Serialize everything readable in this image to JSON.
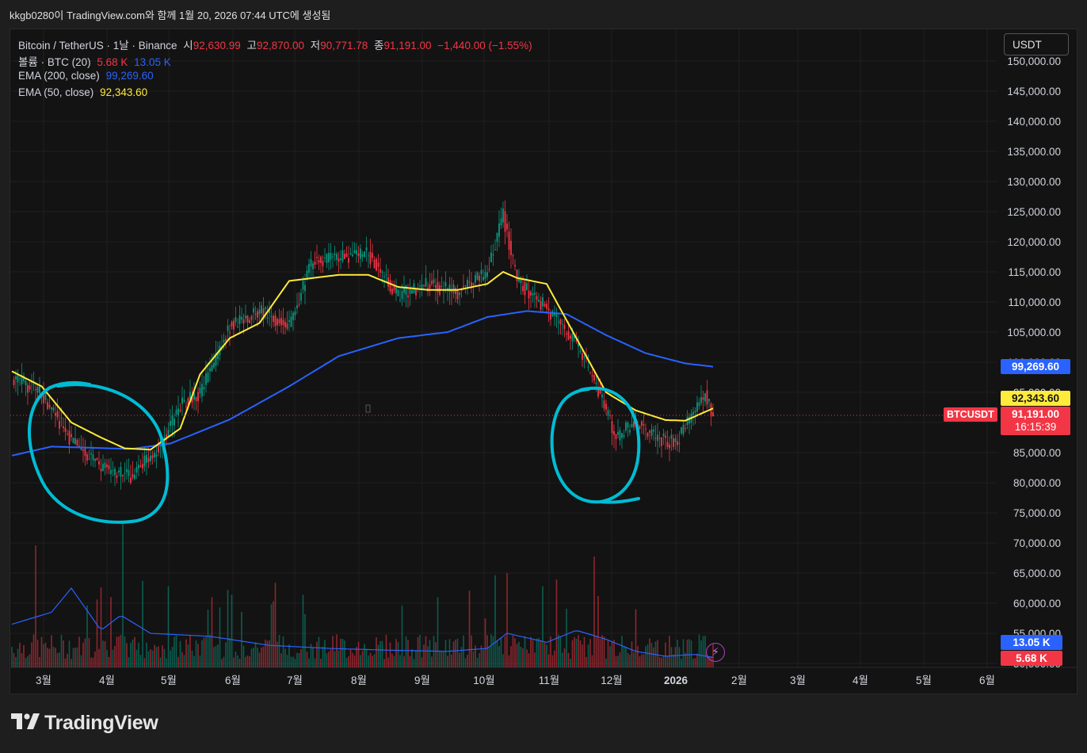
{
  "header": {
    "text": "kkgb0280이 TradingView.com와 함께 1월 20, 2026 07:44 UTC에 생성됨"
  },
  "legend": {
    "symbol": "Bitcoin / TetherUS · 1날 · Binance",
    "open_label": "시",
    "open": "92,630.99",
    "high_label": "고",
    "high": "92,870.00",
    "low_label": "저",
    "low": "90,771.78",
    "close_label": "종",
    "close": "91,191.00",
    "change": "−1,440.00 (−1.55%)",
    "volume_label": "볼륨 · BTC (20)",
    "volume": "5.68 K",
    "volume_ma": "13.05 K",
    "ema200_label": "EMA (200, close)",
    "ema200": "99,269.60",
    "ema50_label": "EMA (50, close)",
    "ema50": "92,343.60"
  },
  "currency_button": "USDT",
  "tags": {
    "ema200": "99,269.60",
    "ema50": "92,343.60",
    "symbol": "BTCUSDT",
    "price": "91,191.00",
    "countdown": "16:15:39",
    "volume_ma": "13.05 K",
    "volume": "5.68 K"
  },
  "footer_logo": "TradingView",
  "colors": {
    "up": "#089981",
    "down": "#f23645",
    "ema50": "#ffeb3b",
    "ema200": "#2962ff",
    "annotation": "#00bcd4",
    "background": "#131313"
  },
  "chart_data": {
    "type": "candlestick",
    "interval": "1D",
    "y_axis_ticks": [
      "150,000.00",
      "145,000.00",
      "140,000.00",
      "135,000.00",
      "130,000.00",
      "125,000.00",
      "120,000.00",
      "115,000.00",
      "110,000.00",
      "105,000.00",
      "100,000.00",
      "95,000.00",
      "90,000.00",
      "85,000.00",
      "80,000.00",
      "75,000.00",
      "70,000.00",
      "65,000.00",
      "60,000.00",
      "55,000.00",
      "50,000.00"
    ],
    "x_axis_ticks": [
      "3월",
      "4월",
      "5월",
      "6월",
      "7월",
      "8월",
      "9월",
      "10월",
      "11월",
      "12월",
      "2026",
      "2월",
      "3월",
      "4월",
      "5월",
      "6월"
    ],
    "ylim": [
      47000,
      152000
    ],
    "price_path": [
      [
        0,
        97500
      ],
      [
        15,
        95000
      ],
      [
        30,
        87000
      ],
      [
        45,
        82500
      ],
      [
        60,
        81000
      ],
      [
        75,
        86000
      ],
      [
        85,
        93000
      ],
      [
        95,
        94800
      ],
      [
        110,
        106000
      ],
      [
        125,
        108500
      ],
      [
        140,
        106000
      ],
      [
        152,
        117000
      ],
      [
        165,
        117500
      ],
      [
        180,
        118000
      ],
      [
        195,
        111000
      ],
      [
        210,
        113000
      ],
      [
        225,
        111500
      ],
      [
        240,
        115000
      ],
      [
        248,
        124500
      ],
      [
        255,
        113500
      ],
      [
        270,
        109000
      ],
      [
        285,
        103000
      ],
      [
        295,
        96000
      ],
      [
        305,
        87500
      ],
      [
        315,
        90000
      ],
      [
        325,
        87500
      ],
      [
        335,
        86500
      ],
      [
        345,
        92000
      ],
      [
        350,
        94800
      ],
      [
        354,
        91191
      ]
    ],
    "ema50_path": [
      [
        0,
        98500
      ],
      [
        15,
        96000
      ],
      [
        30,
        90000
      ],
      [
        45,
        87500
      ],
      [
        57,
        85700
      ],
      [
        70,
        85500
      ],
      [
        85,
        89000
      ],
      [
        95,
        98000
      ],
      [
        110,
        104000
      ],
      [
        125,
        106500
      ],
      [
        140,
        113500
      ],
      [
        165,
        114500
      ],
      [
        180,
        114500
      ],
      [
        195,
        112500
      ],
      [
        210,
        112000
      ],
      [
        225,
        112000
      ],
      [
        240,
        113000
      ],
      [
        248,
        115000
      ],
      [
        255,
        114000
      ],
      [
        270,
        113000
      ],
      [
        285,
        104000
      ],
      [
        300,
        95000
      ],
      [
        315,
        92000
      ],
      [
        330,
        90400
      ],
      [
        340,
        90300
      ],
      [
        354,
        92343
      ]
    ],
    "ema200_path": [
      [
        0,
        84500
      ],
      [
        20,
        86000
      ],
      [
        60,
        85600
      ],
      [
        80,
        86500
      ],
      [
        110,
        90500
      ],
      [
        140,
        96000
      ],
      [
        165,
        101000
      ],
      [
        195,
        104000
      ],
      [
        220,
        105000
      ],
      [
        240,
        107500
      ],
      [
        260,
        108500
      ],
      [
        280,
        108000
      ],
      [
        300,
        104500
      ],
      [
        320,
        101500
      ],
      [
        340,
        99800
      ],
      [
        354,
        99269
      ]
    ],
    "volume_ma_path": [
      [
        0,
        56500
      ],
      [
        20,
        58500
      ],
      [
        30,
        62500
      ],
      [
        45,
        55500
      ],
      [
        55,
        58000
      ],
      [
        70,
        55000
      ],
      [
        100,
        54500
      ],
      [
        130,
        53000
      ],
      [
        160,
        52500
      ],
      [
        190,
        52200
      ],
      [
        220,
        52000
      ],
      [
        240,
        52500
      ],
      [
        250,
        55000
      ],
      [
        270,
        53500
      ],
      [
        285,
        55500
      ],
      [
        300,
        54000
      ],
      [
        315,
        52000
      ],
      [
        330,
        51200
      ],
      [
        345,
        51500
      ],
      [
        354,
        51000
      ]
    ],
    "current_price": 91191,
    "annotations": [
      "circle around Mar–Apr lows",
      "circle around Nov–Dec lows"
    ]
  }
}
